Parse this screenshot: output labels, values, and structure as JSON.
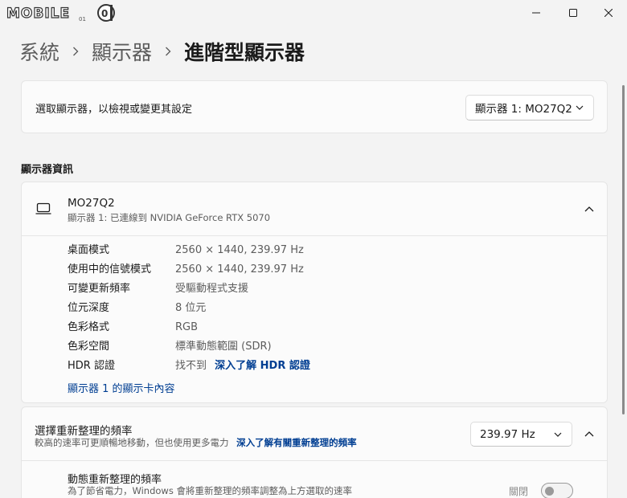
{
  "window": {
    "logo_text": "MOBILE01"
  },
  "breadcrumb": {
    "items": [
      "系統",
      "顯示器",
      "進階型顯示器"
    ]
  },
  "select_display": {
    "label": "選取顯示器，以檢視或變更其設定",
    "selected": "顯示器 1: MO27Q2"
  },
  "display_info": {
    "section_title": "顯示器資訊",
    "name": "MO27Q2",
    "connection": "顯示器 1: 已連線到 NVIDIA GeForce RTX 5070",
    "properties": [
      {
        "label": "桌面模式",
        "value": "2560 × 1440, 239.97 Hz"
      },
      {
        "label": "使用中的信號模式",
        "value": "2560 × 1440, 239.97 Hz"
      },
      {
        "label": "可變更新頻率",
        "value": "受驅動程式支援"
      },
      {
        "label": "位元深度",
        "value": "8 位元"
      },
      {
        "label": "色彩格式",
        "value": "RGB"
      },
      {
        "label": "色彩空間",
        "value": "標準動態範圍 (SDR)"
      }
    ],
    "hdr": {
      "label": "HDR 認證",
      "value": "找不到",
      "link": "深入了解 HDR 認證"
    },
    "adapter_link": "顯示器 1 的顯示卡內容"
  },
  "refresh_rate": {
    "title": "選擇重新整理的頻率",
    "description": "較高的速率可更順暢地移動，但也使用更多電力",
    "link": "深入了解有關重新整理的頻率",
    "selected": "239.97 Hz",
    "dynamic": {
      "title": "動態重新整理的頻率",
      "description": "為了節省電力，Windows 會將重新整理的頻率調整為上方選取的速率",
      "toggle_label": "關閉",
      "toggle_on": false
    }
  }
}
